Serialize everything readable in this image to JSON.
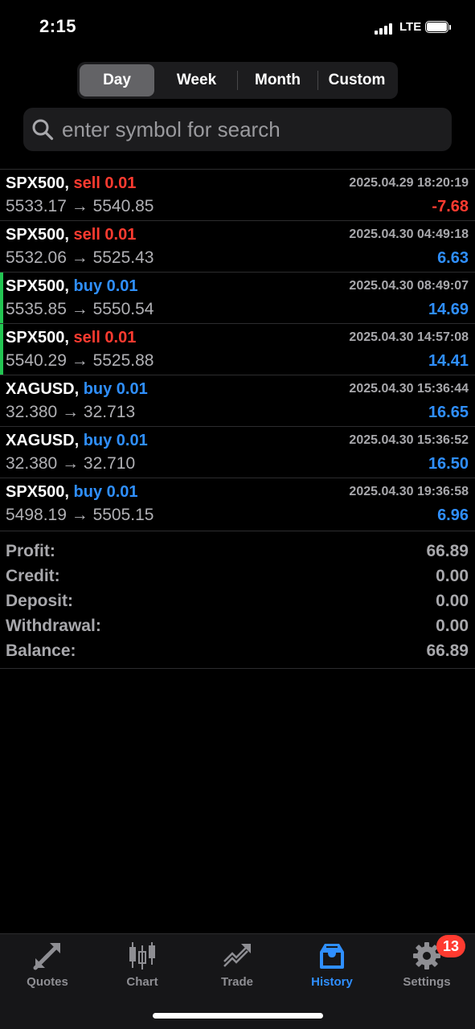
{
  "status_bar": {
    "time": "2:15",
    "network": "LTE"
  },
  "period_tabs": [
    {
      "label": "Day",
      "active": true
    },
    {
      "label": "Week",
      "active": false
    },
    {
      "label": "Month",
      "active": false
    },
    {
      "label": "Custom",
      "active": false
    }
  ],
  "search": {
    "placeholder": "enter symbol for search",
    "value": ""
  },
  "trades": [
    {
      "symbol": "SPX500,",
      "side": "sell 0.01",
      "type": "sell",
      "date": "2025.04.29 18:20:19",
      "prices": "5533.17 → 5540.85",
      "profit": "-7.68"
    },
    {
      "symbol": "SPX500,",
      "side": "sell 0.01",
      "type": "sell",
      "date": "2025.04.30 04:49:18",
      "prices": "5532.06 → 5525.43",
      "profit": "6.63"
    },
    {
      "symbol": "SPX500,",
      "side": "buy 0.01",
      "type": "buy",
      "date": "2025.04.30 08:49:07",
      "prices": "5535.85 → 5550.54",
      "profit": "14.69"
    },
    {
      "symbol": "SPX500,",
      "side": "sell 0.01",
      "type": "sell",
      "date": "2025.04.30 14:57:08",
      "prices": "5540.29 → 5525.88",
      "profit": "14.41"
    },
    {
      "symbol": "XAGUSD,",
      "side": "buy 0.01",
      "type": "buy",
      "date": "2025.04.30 15:36:44",
      "prices": "32.380 → 32.713",
      "profit": "16.65"
    },
    {
      "symbol": "XAGUSD,",
      "side": "buy 0.01",
      "type": "buy",
      "date": "2025.04.30 15:36:52",
      "prices": "32.380 → 32.710",
      "profit": "16.50"
    },
    {
      "symbol": "SPX500,",
      "side": "buy 0.01",
      "type": "buy",
      "date": "2025.04.30 19:36:58",
      "prices": "5498.19 → 5505.15",
      "profit": "6.96"
    }
  ],
  "summary": [
    {
      "label": "Profit:",
      "value": "66.89"
    },
    {
      "label": "Credit:",
      "value": "0.00"
    },
    {
      "label": "Deposit:",
      "value": "0.00"
    },
    {
      "label": "Withdrawal:",
      "value": "0.00"
    },
    {
      "label": "Balance:",
      "value": "66.89"
    }
  ],
  "tabbar": {
    "items": [
      {
        "label": "Quotes",
        "icon": "quotes-arrows-icon"
      },
      {
        "label": "Chart",
        "icon": "candlestick-chart-icon"
      },
      {
        "label": "Trade",
        "icon": "trade-trend-icon"
      },
      {
        "label": "History",
        "icon": "history-inbox-icon",
        "active": true
      },
      {
        "label": "Settings",
        "icon": "gear-icon"
      }
    ],
    "settings_badge": "13"
  },
  "colors": {
    "sell": "#ff3b30",
    "buy": "#2f8fff",
    "active_tab": "#2f8fff",
    "row_marker": "#23c552"
  }
}
